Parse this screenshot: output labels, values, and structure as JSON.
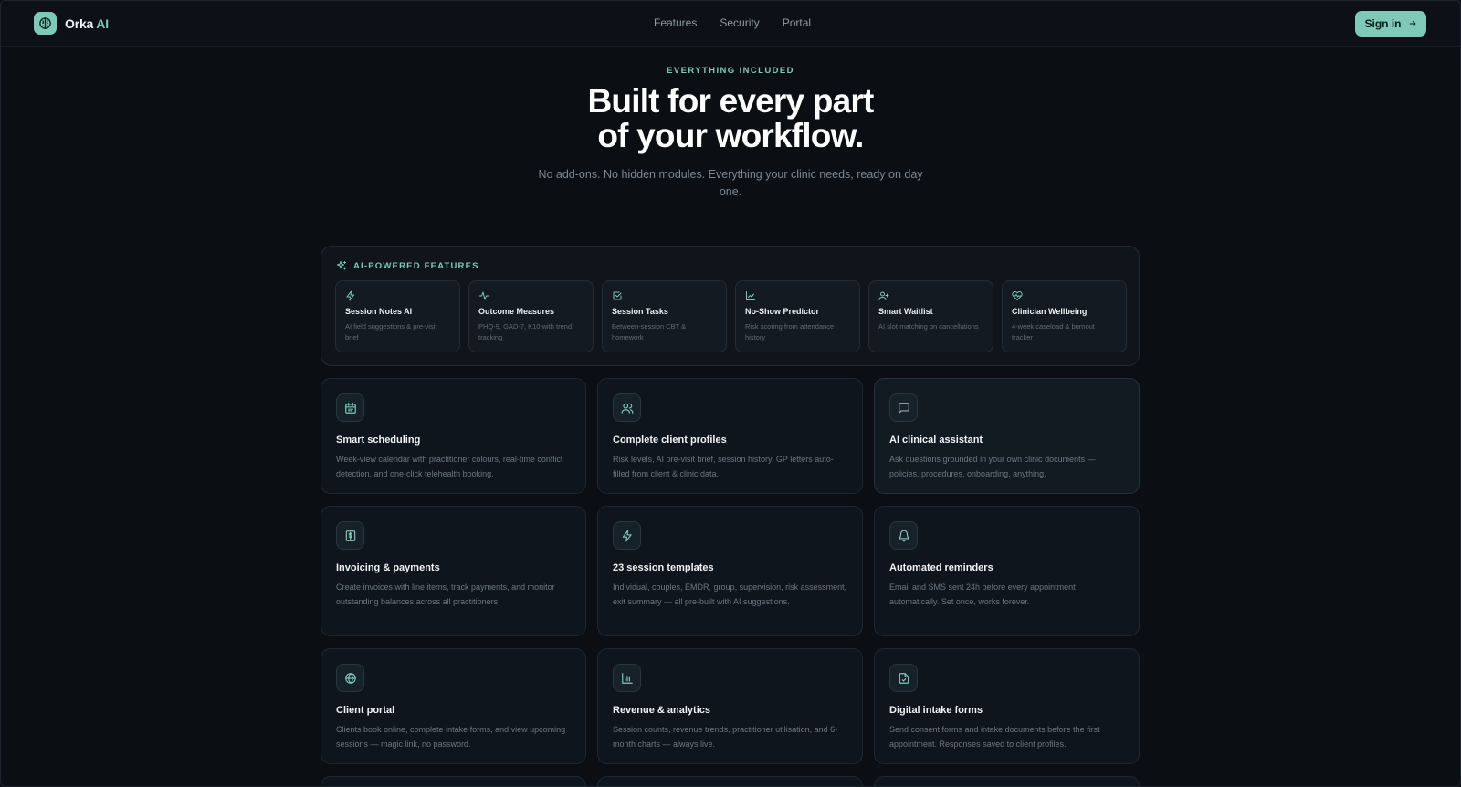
{
  "brand": {
    "name": "Orka",
    "accent": "AI"
  },
  "nav": {
    "links": [
      "Features",
      "Security",
      "Portal"
    ],
    "signin_label": "Sign in"
  },
  "hero": {
    "eyebrow": "EVERYTHING INCLUDED",
    "title_line1": "Built for every part",
    "title_line2": "of your workflow.",
    "subtitle": "No add-ons. No hidden modules. Everything your clinic needs, ready on day one."
  },
  "ai_panel": {
    "label": "AI-POWERED FEATURES",
    "items": [
      {
        "icon": "zap-icon",
        "title": "Session Notes AI",
        "desc": "AI field suggestions & pre-visit brief"
      },
      {
        "icon": "activity-icon",
        "title": "Outcome Measures",
        "desc": "PHQ-9, GAD-7, K10 with trend tracking"
      },
      {
        "icon": "checkbox-icon",
        "title": "Session Tasks",
        "desc": "Between-session CBT & homework"
      },
      {
        "icon": "trend-chart-icon",
        "title": "No-Show Predictor",
        "desc": "Risk scoring from attendance history"
      },
      {
        "icon": "user-plus-icon",
        "title": "Smart Waitlist",
        "desc": "AI slot-matching on cancellations"
      },
      {
        "icon": "heart-pulse-icon",
        "title": "Clinician Wellbeing",
        "desc": "4-week caseload & burnout tracker"
      }
    ]
  },
  "features": [
    {
      "icon": "calendar-icon",
      "title": "Smart scheduling",
      "desc": "Week-view calendar with practitioner colours, real-time conflict detection, and one-click telehealth booking."
    },
    {
      "icon": "users-icon",
      "title": "Complete client profiles",
      "desc": "Risk levels, AI pre-visit brief, session history, GP letters auto-filled from client & clinic data."
    },
    {
      "icon": "message-icon",
      "title": "AI clinical assistant",
      "desc": "Ask questions grounded in your own clinic documents — policies, procedures, onboarding, anything."
    },
    {
      "icon": "invoice-icon",
      "title": "Invoicing & payments",
      "desc": "Create invoices with line items, track payments, and monitor outstanding balances across all practitioners."
    },
    {
      "icon": "zap-icon",
      "title": "23 session templates",
      "desc": "Individual, couples, EMDR, group, supervision, risk assessment, exit summary — all pre-built with AI suggestions."
    },
    {
      "icon": "bell-icon",
      "title": "Automated reminders",
      "desc": "Email and SMS sent 24h before every appointment automatically. Set once, works forever."
    },
    {
      "icon": "globe-icon",
      "title": "Client portal",
      "desc": "Clients book online, complete intake forms, and view upcoming sessions — magic link, no password."
    },
    {
      "icon": "bar-chart-icon",
      "title": "Revenue & analytics",
      "desc": "Session counts, revenue trends, practitioner utilisation, and 6-month charts — always live."
    },
    {
      "icon": "file-check-icon",
      "title": "Digital intake forms",
      "desc": "Send consent forms and intake documents before the first appointment. Responses saved to client profiles."
    }
  ],
  "colors": {
    "accent": "#7fc9b8",
    "background": "#0b0f14",
    "card": "#0f151c"
  }
}
